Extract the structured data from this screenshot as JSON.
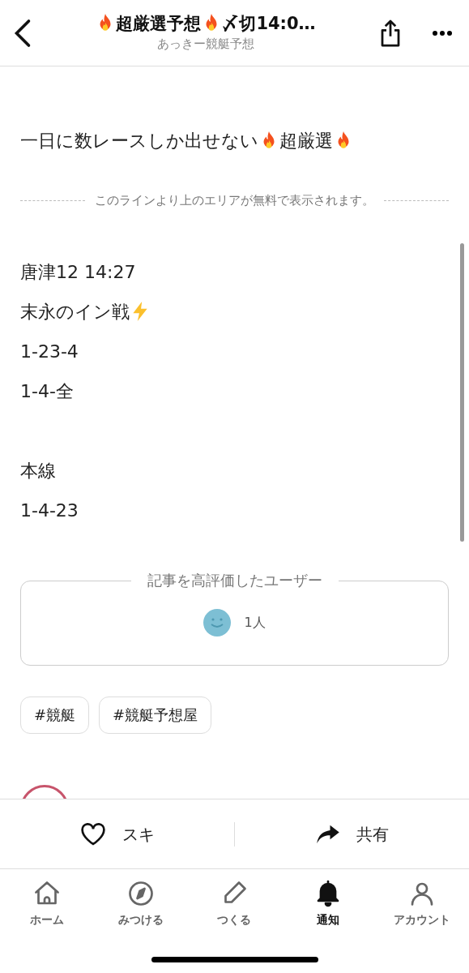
{
  "header": {
    "title_parts": [
      {
        "kind": "fire"
      },
      {
        "kind": "text",
        "text": "超厳選予想"
      },
      {
        "kind": "fire"
      },
      {
        "kind": "text",
        "text": "〆切14:0…"
      }
    ],
    "subtitle": "あっきー競艇予想"
  },
  "intro_parts": [
    {
      "kind": "text",
      "text": "一日に数レースしか出せない"
    },
    {
      "kind": "fire"
    },
    {
      "kind": "text",
      "text": "超厳選"
    },
    {
      "kind": "fire"
    }
  ],
  "free_line": "このラインより上のエリアが無料で表示されます。",
  "body_lines": [
    {
      "parts": [
        {
          "kind": "text",
          "text": "唐津12 14:27"
        }
      ]
    },
    {
      "parts": [
        {
          "kind": "text",
          "text": "末永のイン戦"
        },
        {
          "kind": "bolt"
        }
      ]
    },
    {
      "parts": [
        {
          "kind": "text",
          "text": "1-23-4"
        }
      ]
    },
    {
      "parts": [
        {
          "kind": "text",
          "text": "1-4-全"
        }
      ]
    },
    {
      "kind": "blank"
    },
    {
      "parts": [
        {
          "kind": "text",
          "text": "本線"
        }
      ]
    },
    {
      "parts": [
        {
          "kind": "text",
          "text": "1-4-23"
        }
      ]
    }
  ],
  "likers": {
    "title": "記事を高評価したユーザー",
    "count": "1人"
  },
  "tags": [
    "#競艇",
    "#競艇予想屋"
  ],
  "actions": [
    {
      "kind": "like",
      "label": "スキ"
    },
    {
      "kind": "share",
      "label": "共有"
    }
  ],
  "tabs": [
    {
      "kind": "home",
      "label": "ホーム",
      "selected": false
    },
    {
      "kind": "discover",
      "label": "みつける",
      "selected": false
    },
    {
      "kind": "create",
      "label": "つくる",
      "selected": false
    },
    {
      "kind": "notify",
      "label": "通知",
      "selected": true
    },
    {
      "kind": "account",
      "label": "アカウント",
      "selected": false
    }
  ]
}
